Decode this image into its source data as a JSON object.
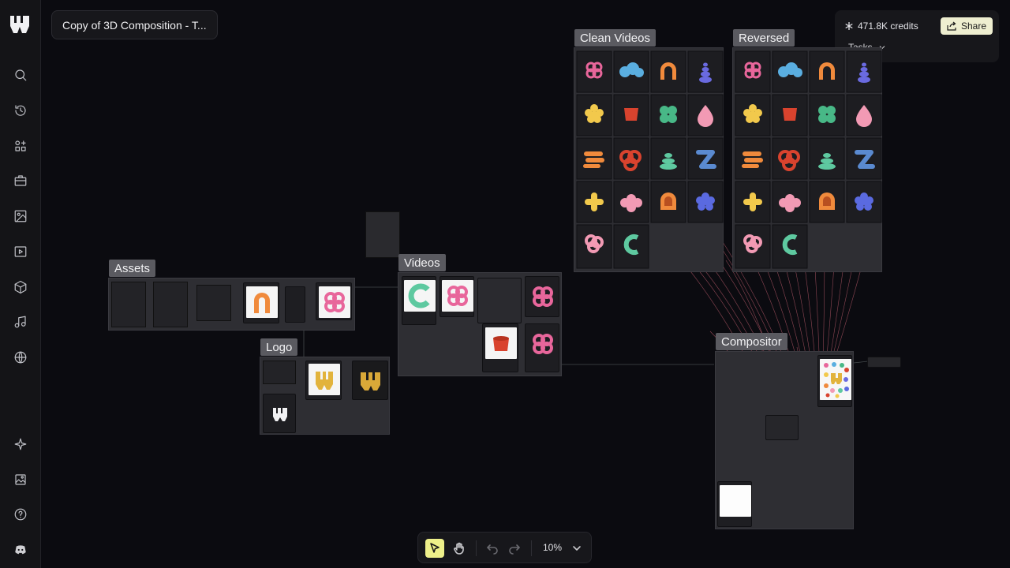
{
  "app": {
    "title": "Copy of 3D Composition - T...",
    "credits": "471.8K credits",
    "share_label": "Share",
    "tasks_label": "Tasks"
  },
  "sidebar": {
    "items": [
      {
        "name": "search",
        "icon": "search-icon"
      },
      {
        "name": "history",
        "icon": "history-icon"
      },
      {
        "name": "apps",
        "icon": "apps-icon"
      },
      {
        "name": "toolbox",
        "icon": "briefcase-icon"
      },
      {
        "name": "image",
        "icon": "image-icon"
      },
      {
        "name": "video",
        "icon": "video-icon"
      },
      {
        "name": "3d",
        "icon": "cube-icon"
      },
      {
        "name": "audio",
        "icon": "music-icon"
      },
      {
        "name": "web",
        "icon": "globe-icon"
      }
    ],
    "bottom_items": [
      {
        "name": "ai",
        "icon": "sparkle-icon"
      },
      {
        "name": "gallery",
        "icon": "gallery-icon"
      },
      {
        "name": "help",
        "icon": "help-icon"
      },
      {
        "name": "discord",
        "icon": "discord-icon"
      }
    ]
  },
  "canvas": {
    "groups": [
      {
        "id": "assets",
        "label": "Assets"
      },
      {
        "id": "logo",
        "label": "Logo"
      },
      {
        "id": "videos",
        "label": "Videos"
      },
      {
        "id": "clean_videos",
        "label": "Clean Videos"
      },
      {
        "id": "reversed",
        "label": "Reversed"
      },
      {
        "id": "compositor",
        "label": "Compositor"
      }
    ],
    "accent_colors": {
      "pink": "#e8669b",
      "blue": "#5aaee0",
      "orange": "#f08a3c",
      "purple": "#6a6ae0",
      "yellow": "#f2c94c",
      "red": "#d9432e",
      "green": "#48b887",
      "mint": "#5ec9a0",
      "wire": "#c86a7a"
    }
  },
  "toolbar": {
    "zoom": "10%",
    "tools": [
      "select-tool",
      "hand-tool",
      "undo",
      "redo"
    ]
  }
}
